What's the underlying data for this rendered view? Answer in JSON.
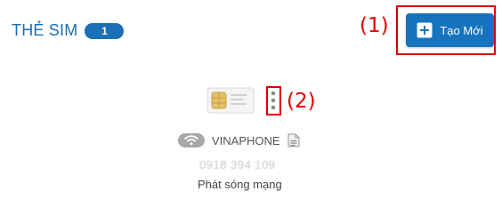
{
  "header": {
    "title": "THẺ SIM",
    "count": "1"
  },
  "toolbar": {
    "create_label": "Tạo Mới",
    "icon": "plus-icon"
  },
  "annotations": {
    "label_1": "(1)",
    "label_2": "(2)",
    "color": "#e00000"
  },
  "sim_card": {
    "carrier": "VINAPHONE",
    "phone_number": "0918 394 109",
    "status": "Phát sóng mạng",
    "icons": [
      "sim-card-icon",
      "more-vertical-icon",
      "wifi-icon",
      "document-icon"
    ]
  },
  "colors": {
    "brand_blue": "#1a6fb6",
    "button_blue": "#1674bd"
  }
}
